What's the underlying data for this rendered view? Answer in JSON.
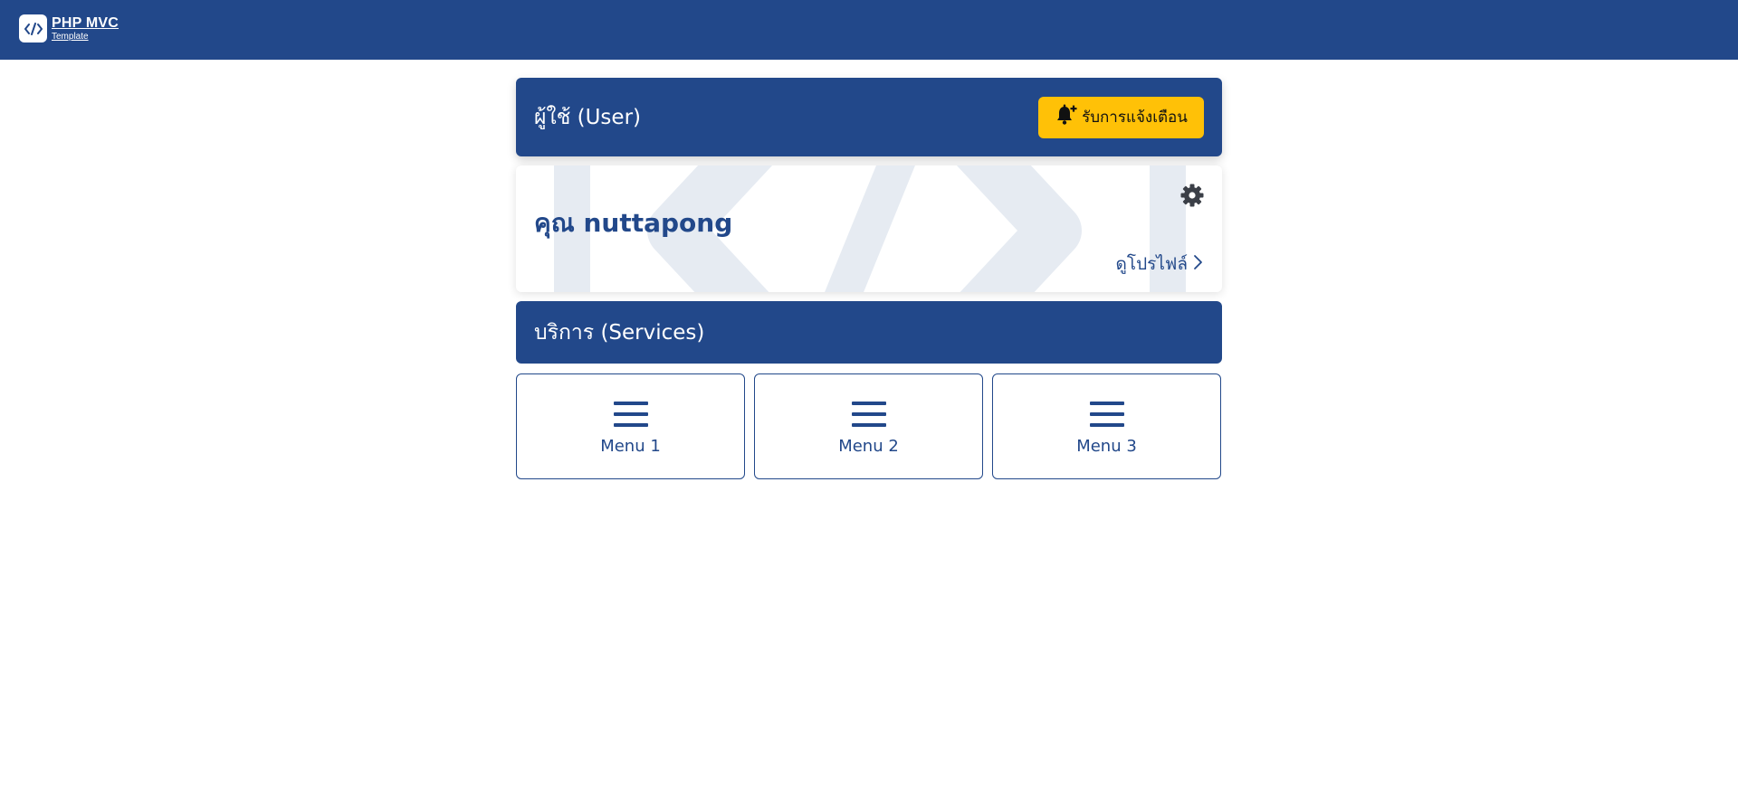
{
  "header": {
    "brand_title": "PHP MVC",
    "brand_subtitle": "Template",
    "brand_icon": "code-icon"
  },
  "user_panel": {
    "title": "ผู้ใช้ (User)",
    "notify_label": "รับการแจ้งเตือน",
    "notify_icon": "bell-plus-icon"
  },
  "profile": {
    "name": "คุณ nuttapong",
    "view_profile_label": "ดูโปรไฟล์",
    "settings_icon": "gear-icon"
  },
  "services_panel": {
    "title": "บริการ (Services)"
  },
  "menus": [
    {
      "label": "Menu 1",
      "icon": "hamburger-icon"
    },
    {
      "label": "Menu 2",
      "icon": "hamburger-icon"
    },
    {
      "label": "Menu 3",
      "icon": "hamburger-icon"
    }
  ],
  "colors": {
    "primary": "#22488a",
    "accent": "#ffc107",
    "watermark": "#e6ebf2"
  }
}
